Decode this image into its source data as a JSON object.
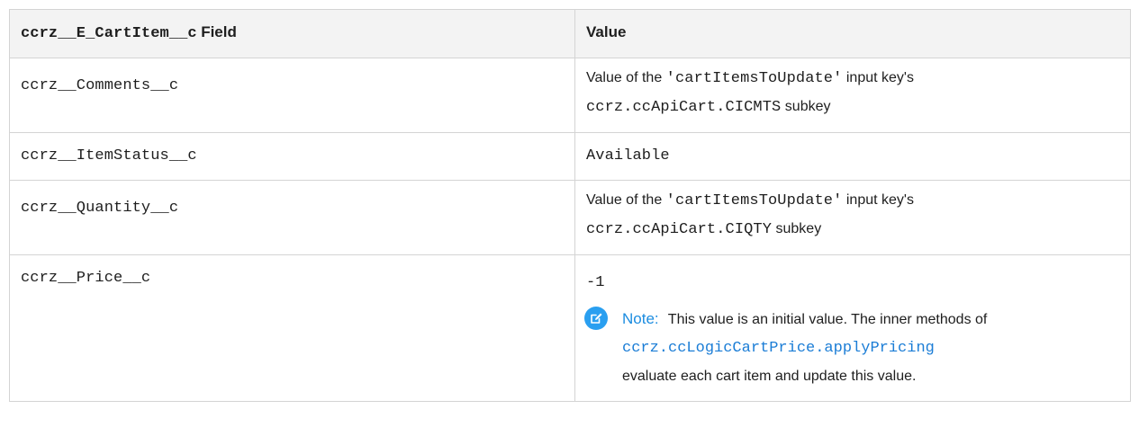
{
  "table": {
    "header": {
      "field_code": "ccrz__E_CartItem__c",
      "field_word": "Field",
      "value": "Value"
    },
    "rows": [
      {
        "field": "ccrz__Comments__c",
        "value_prefix": "Value of the",
        "value_key": "'cartItemsToUpdate'",
        "value_suffix": "input key's",
        "value_subkey": "ccrz.ccApiCart.CICMTS",
        "value_end": "subkey"
      },
      {
        "field": "ccrz__ItemStatus__c",
        "value": "Available"
      },
      {
        "field": "ccrz__Quantity__c",
        "value_prefix": "Value of the",
        "value_key": "'cartItemsToUpdate'",
        "value_suffix": "input key's",
        "value_subkey": "ccrz.ccApiCart.CIQTY",
        "value_end": "subkey"
      },
      {
        "field": "ccrz__Price__c",
        "value": "-1",
        "note": {
          "label": "Note:",
          "text_before": "This value is an initial value. The inner methods of",
          "link": "ccrz.ccLogicCartPrice.applyPricing",
          "text_after": "evaluate each cart item and update this value."
        }
      }
    ]
  },
  "icons": {
    "note_icon": "note-edit-icon",
    "note_color": "#2a9ff0",
    "link_color": "#1b7dd6"
  }
}
